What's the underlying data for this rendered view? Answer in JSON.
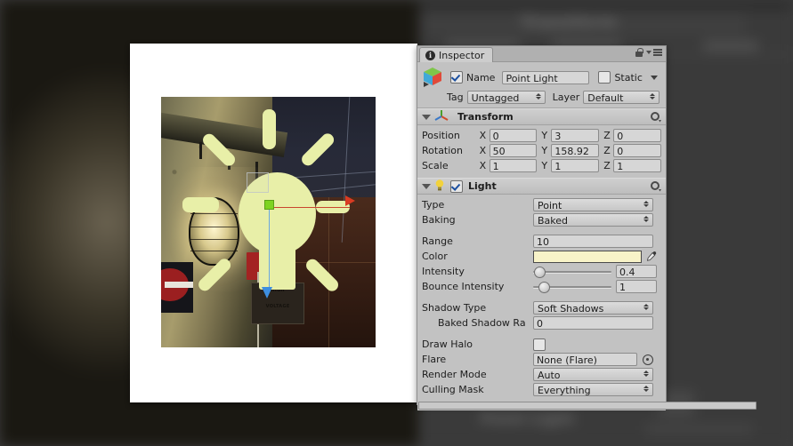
{
  "window": {
    "inspector_tab": "Inspector",
    "info_glyph": "i"
  },
  "object_header": {
    "enabled_checkbox": true,
    "name_label": "Name",
    "name_value": "Point Light",
    "static_label": "Static",
    "static_checked": false,
    "tag_label": "Tag",
    "tag_value": "Untagged",
    "layer_label": "Layer",
    "layer_value": "Default"
  },
  "transform": {
    "title": "Transform",
    "rows": [
      {
        "label": "Position",
        "x": "0",
        "y": "3",
        "z": "0"
      },
      {
        "label": "Rotation",
        "x": "50",
        "y": "158.92",
        "z": "0"
      },
      {
        "label": "Scale",
        "x": "1",
        "y": "1",
        "z": "1"
      }
    ],
    "axis_x": "X",
    "axis_y": "Y",
    "axis_z": "Z"
  },
  "light": {
    "title": "Light",
    "enabled": true,
    "type_label": "Type",
    "type_value": "Point",
    "baking_label": "Baking",
    "baking_value": "Baked",
    "range_label": "Range",
    "range_value": "10",
    "color_label": "Color",
    "color_value": "#F8F3C8",
    "intensity_label": "Intensity",
    "intensity_value": "0.4",
    "intensity_pct": 7,
    "bounce_label": "Bounce Intensity",
    "bounce_value": "1",
    "bounce_pct": 13,
    "shadow_type_label": "Shadow Type",
    "shadow_type_value": "Soft Shadows",
    "baked_shadow_label": "Baked Shadow Ra",
    "baked_shadow_value": "0",
    "draw_halo_label": "Draw Halo",
    "draw_halo_checked": false,
    "flare_label": "Flare",
    "flare_value": "None (Flare)",
    "render_mode_label": "Render Mode",
    "render_mode_value": "Auto",
    "culling_mask_label": "Culling Mask",
    "culling_mask_value": "Everything"
  },
  "scene": {
    "hv_line1": "HIGH",
    "hv_line2": "VOLTAGE",
    "gizmo_name": "point-light-bulb-gizmo"
  },
  "colors": {
    "panel": "#C2C2C2",
    "field": "#D6D6D6",
    "gizmo_bulb": "#E8EFA8",
    "axis_x": "#D93B22",
    "axis_z": "#3D8EE0",
    "axis_center": "#7ED321",
    "light_color": "#F8F3C8"
  }
}
